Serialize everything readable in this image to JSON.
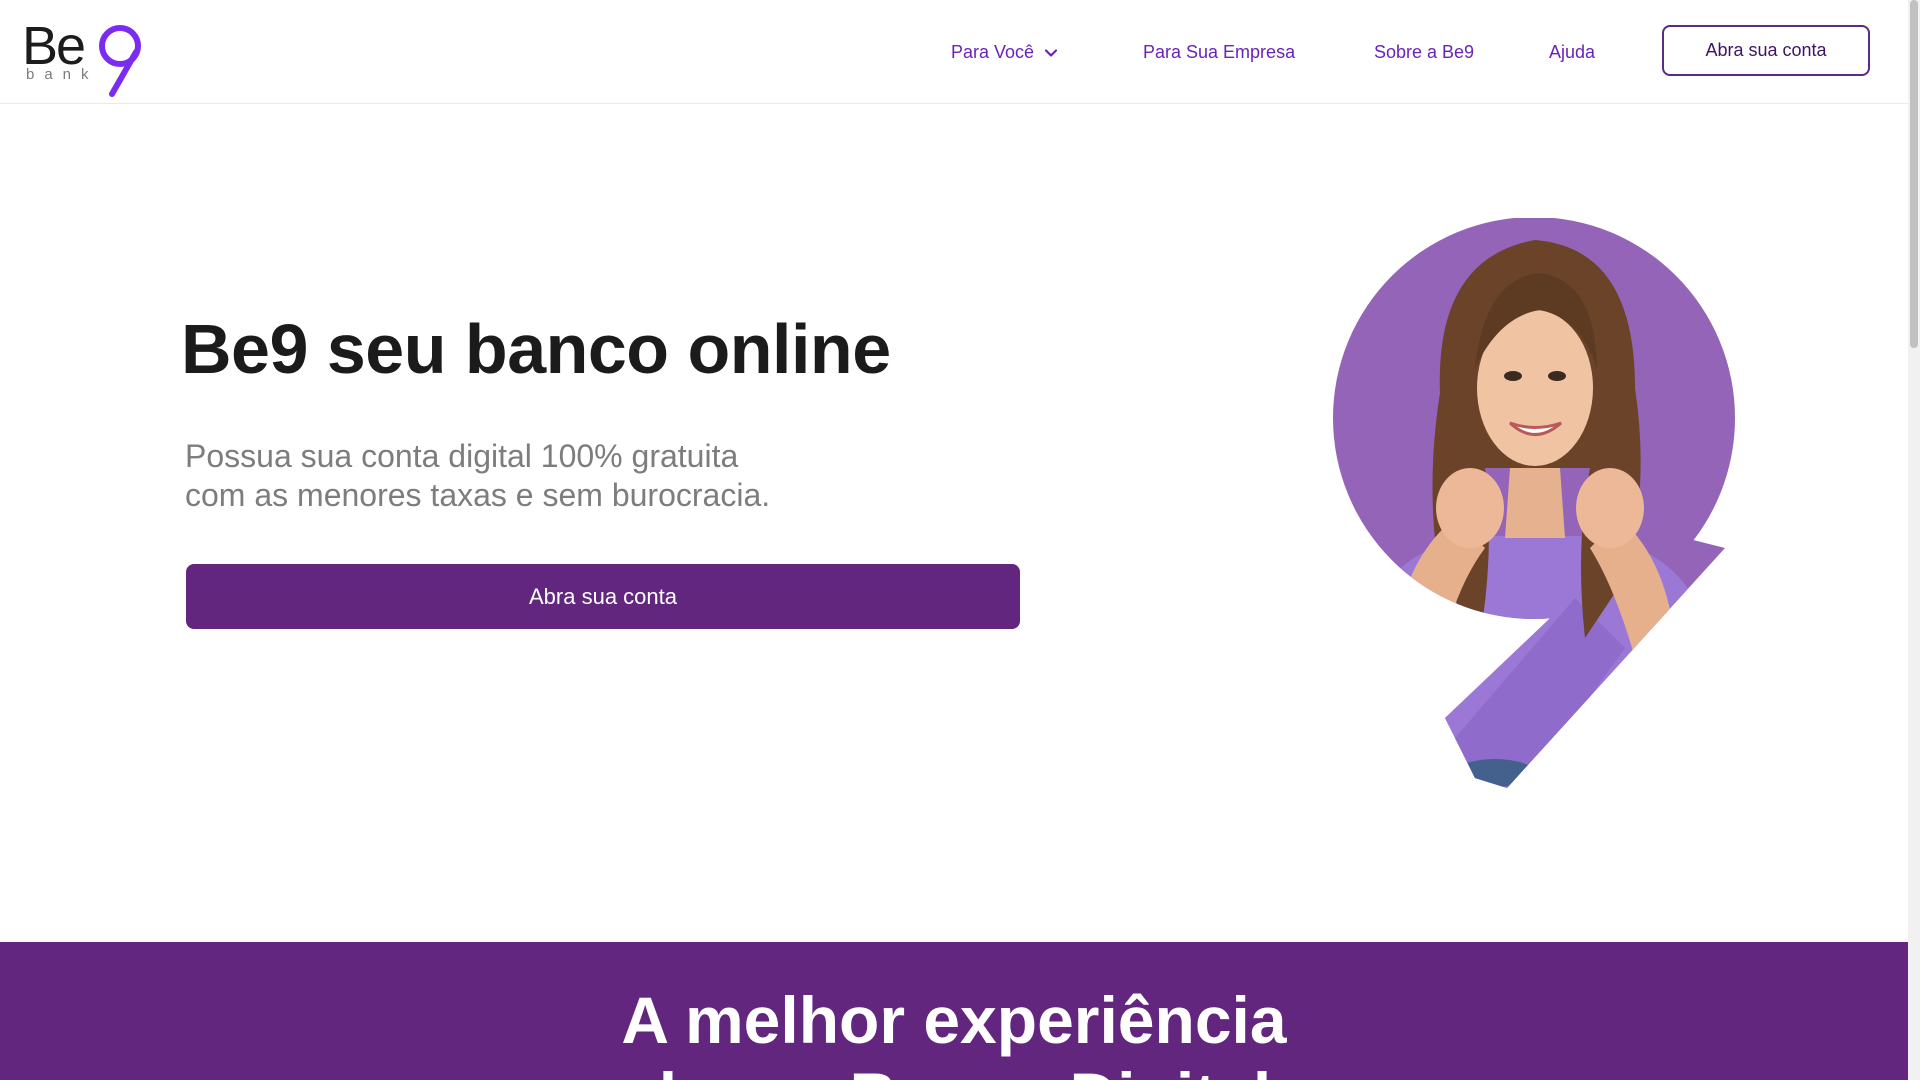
{
  "brand": {
    "name": "Be",
    "digit": "9",
    "sub": "bank",
    "accent_color": "#6a22b8",
    "primary_color": "#62267e"
  },
  "nav": {
    "items": [
      {
        "label": "Para Você",
        "has_dropdown": true
      },
      {
        "label": "Para Sua Empresa"
      },
      {
        "label": "Sobre a Be9"
      },
      {
        "label": "Ajuda"
      }
    ],
    "cta_label": "Abra sua conta"
  },
  "hero": {
    "title": "Be9 seu banco online",
    "subtitle_lines": [
      "Possua sua conta digital 100% gratuita",
      "com as menores taxas e sem burocracia."
    ],
    "cta_label": "Abra sua conta",
    "image": "woman-pointing-in-nine-shape"
  },
  "band": {
    "title_lines": [
      "A melhor experiência",
      "de um Banco Digital"
    ]
  }
}
